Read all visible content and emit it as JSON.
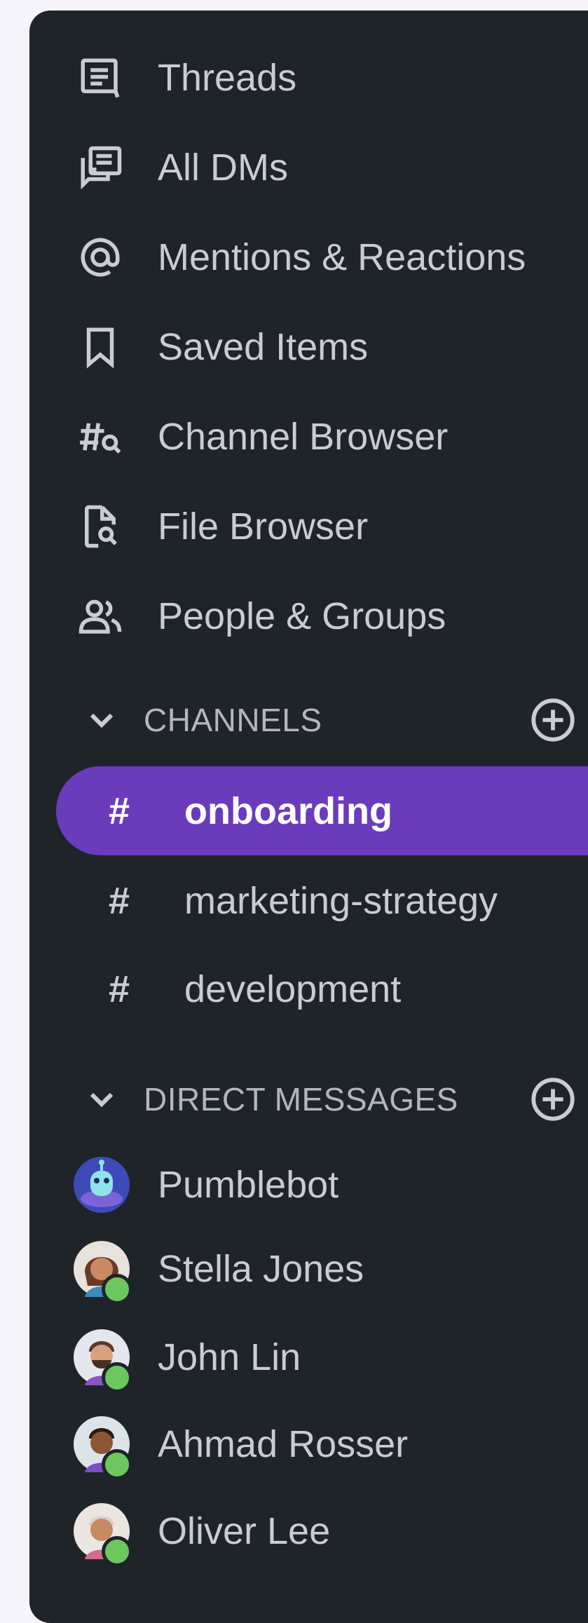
{
  "nav": [
    {
      "label": "Threads",
      "icon": "threads-icon"
    },
    {
      "label": "All DMs",
      "icon": "all-dms-icon"
    },
    {
      "label": "Mentions & Reactions",
      "icon": "at-icon"
    },
    {
      "label": "Saved Items",
      "icon": "bookmark-icon"
    },
    {
      "label": "Channel Browser",
      "icon": "channel-search-icon"
    },
    {
      "label": "File Browser",
      "icon": "file-search-icon"
    },
    {
      "label": "People & Groups",
      "icon": "people-icon"
    }
  ],
  "channels": {
    "title": "CHANNELS",
    "items": [
      {
        "label": "onboarding",
        "active": true
      },
      {
        "label": "marketing-strategy",
        "active": false
      },
      {
        "label": "development",
        "active": false
      }
    ]
  },
  "direct_messages": {
    "title": "DIRECT MESSAGES",
    "items": [
      {
        "label": "Pumblebot",
        "online": false
      },
      {
        "label": "Stella Jones",
        "online": true
      },
      {
        "label": "John Lin",
        "online": true
      },
      {
        "label": "Ahmad Rosser",
        "online": true
      },
      {
        "label": "Oliver Lee",
        "online": true
      }
    ]
  },
  "colors": {
    "sidebar_bg": "#1f2429",
    "active_bg": "#6a3cbc",
    "text": "#c9ccd1",
    "online": "#6cc75e"
  }
}
